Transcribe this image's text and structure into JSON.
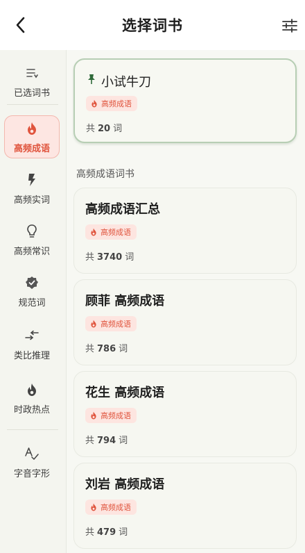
{
  "header": {
    "title": "选择词书"
  },
  "sidebar": {
    "items": [
      {
        "label": "已选词书",
        "icon": "list-icon"
      },
      {
        "label": "高频成语",
        "icon": "flame-icon",
        "active": true
      },
      {
        "label": "高频实词",
        "icon": "bolt-icon"
      },
      {
        "label": "高频常识",
        "icon": "lightbulb-icon"
      },
      {
        "label": "规范词",
        "icon": "verified-badge-icon"
      },
      {
        "label": "类比推理",
        "icon": "swap-arrows-icon"
      },
      {
        "label": "时政热点",
        "icon": "flame-icon"
      },
      {
        "label": "字音字形",
        "icon": "spell-check-icon"
      }
    ]
  },
  "main": {
    "featured": {
      "name": "小试牛刀",
      "tag": "高频成语",
      "count_prefix": "共",
      "count": "20",
      "count_suffix": "词"
    },
    "section_title": "高频成语词书",
    "books": [
      {
        "name": "高频成语汇总",
        "tag": "高频成语",
        "count_prefix": "共",
        "count": "3740",
        "count_suffix": "词"
      },
      {
        "name": "顾菲 高频成语",
        "tag": "高频成语",
        "count_prefix": "共",
        "count": "786",
        "count_suffix": "词"
      },
      {
        "name": "花生 高频成语",
        "tag": "高频成语",
        "count_prefix": "共",
        "count": "794",
        "count_suffix": "词"
      },
      {
        "name": "刘岩 高频成语",
        "tag": "高频成语",
        "count_prefix": "共",
        "count": "479",
        "count_suffix": "词"
      }
    ]
  },
  "colors": {
    "accent": "#e0543d",
    "tag_bg": "#fde5e0",
    "featured_border": "#b7ceb4",
    "pin": "#2f6a3a"
  }
}
